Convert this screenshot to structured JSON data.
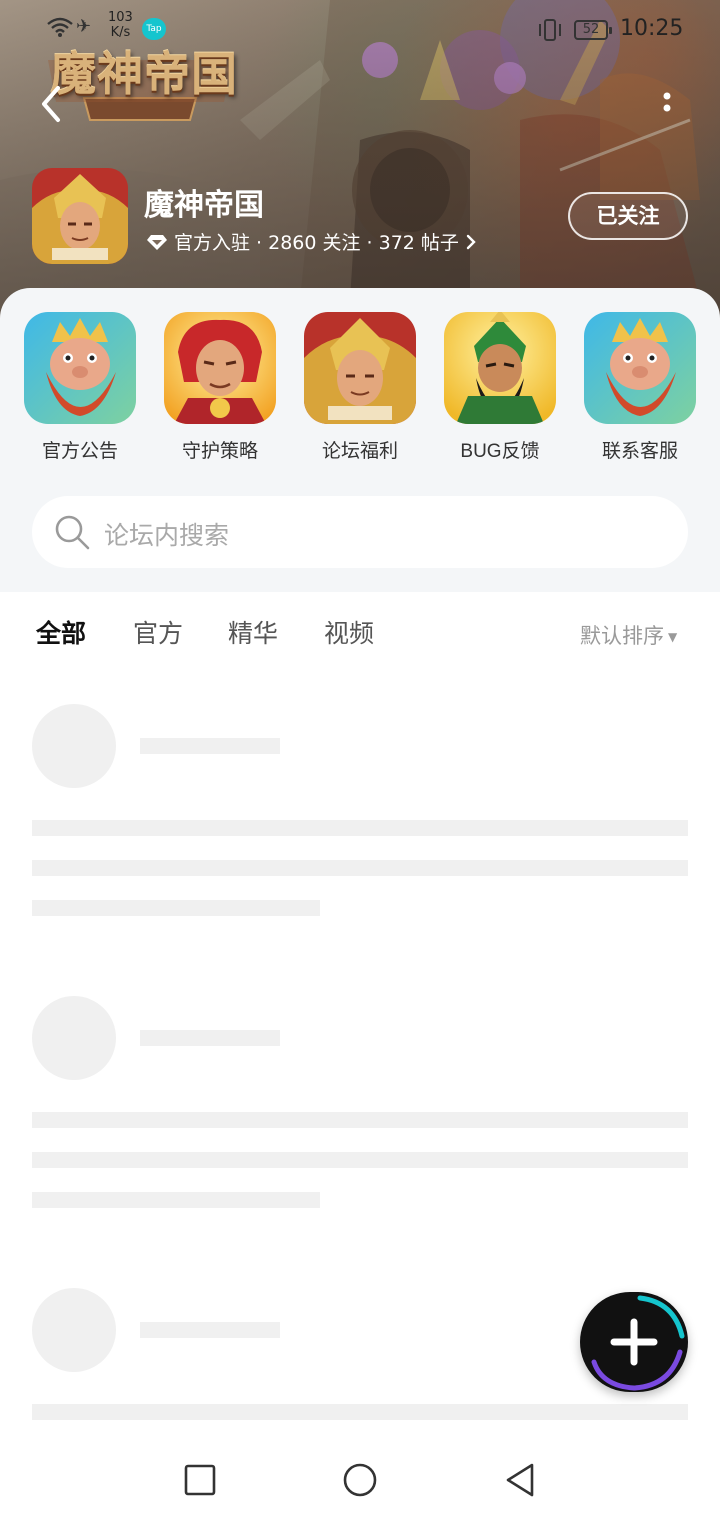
{
  "status_bar": {
    "net_speed_value": "103",
    "net_speed_unit": "K/s",
    "tap_badge": "Tap",
    "battery": "52",
    "time": "10:25"
  },
  "forum": {
    "logo_text": "魔神帝国",
    "name": "魔神帝国",
    "meta": "官方入驻 · 2860 关注 · 372 帖子",
    "follow_label": "已关注"
  },
  "quick_entries": [
    {
      "label": "官方公告",
      "icon": "red-beard-king-icon"
    },
    {
      "label": "守护策略",
      "icon": "red-haired-warrior-icon"
    },
    {
      "label": "论坛福利",
      "icon": "golden-helmet-king-icon"
    },
    {
      "label": "BUG反馈",
      "icon": "green-general-icon"
    },
    {
      "label": "联系客服",
      "icon": "red-beard-king-icon"
    }
  ],
  "search": {
    "placeholder": "论坛内搜索"
  },
  "tabs": [
    {
      "label": "全部",
      "active": true
    },
    {
      "label": "官方",
      "active": false
    },
    {
      "label": "精华",
      "active": false
    },
    {
      "label": "视频",
      "active": false
    }
  ],
  "sort_label": "默认排序",
  "colors": {
    "accent": "#15c5ce",
    "skeleton": "#f0f0f0",
    "panel_bg": "#f4f6f8"
  }
}
